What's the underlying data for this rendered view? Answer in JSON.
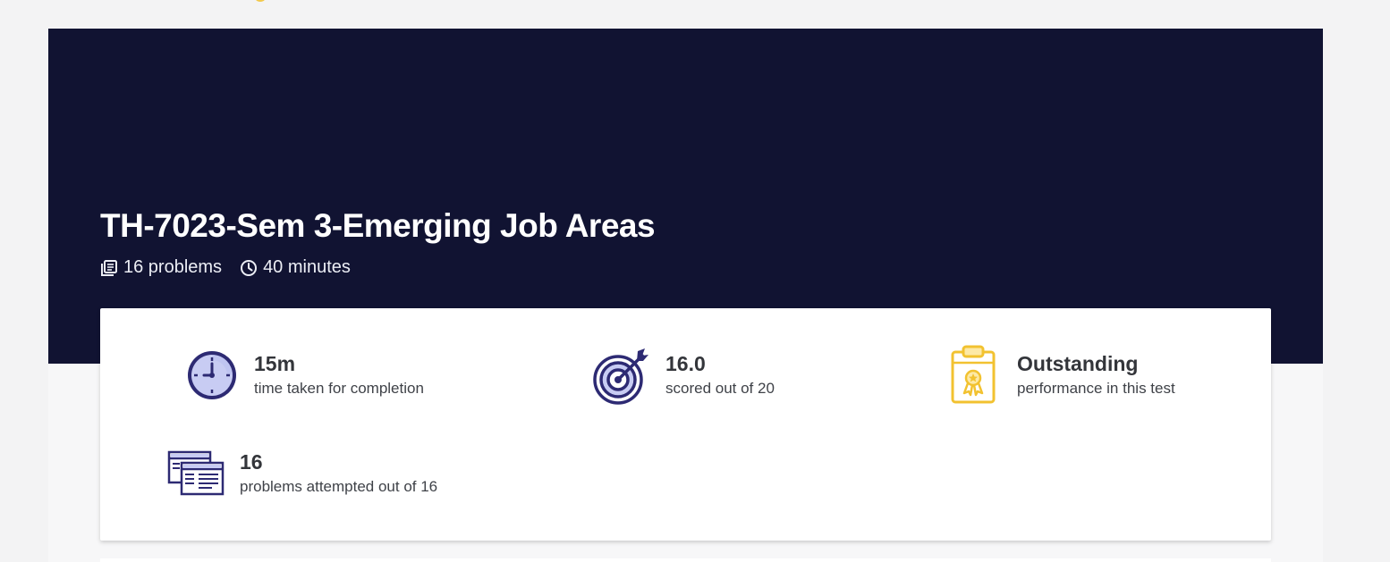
{
  "test": {
    "title": "TH-7023-Sem 3-Emerging Job Areas",
    "problems": "16 problems",
    "duration": "40 minutes"
  },
  "icons": {
    "problems": "book-stack-icon",
    "duration": "clock-icon",
    "time_taken": "clock-face-icon",
    "score": "target-dart-icon",
    "performance": "clipboard-award-icon",
    "attempted": "windows-documents-icon"
  },
  "stats": {
    "time_taken": {
      "value": "15m",
      "caption": "time taken for completion"
    },
    "score": {
      "value": "16.0",
      "caption": "scored out of 20"
    },
    "performance": {
      "value": "Outstanding",
      "caption": "performance in this test"
    },
    "attempted": {
      "value": "16",
      "caption": "problems attempted out of 16"
    }
  },
  "colors": {
    "hero_background": "#111332",
    "icon_navy": "#2d2a73",
    "icon_lavender": "#c8ccf3",
    "icon_gold": "#f2c230"
  }
}
